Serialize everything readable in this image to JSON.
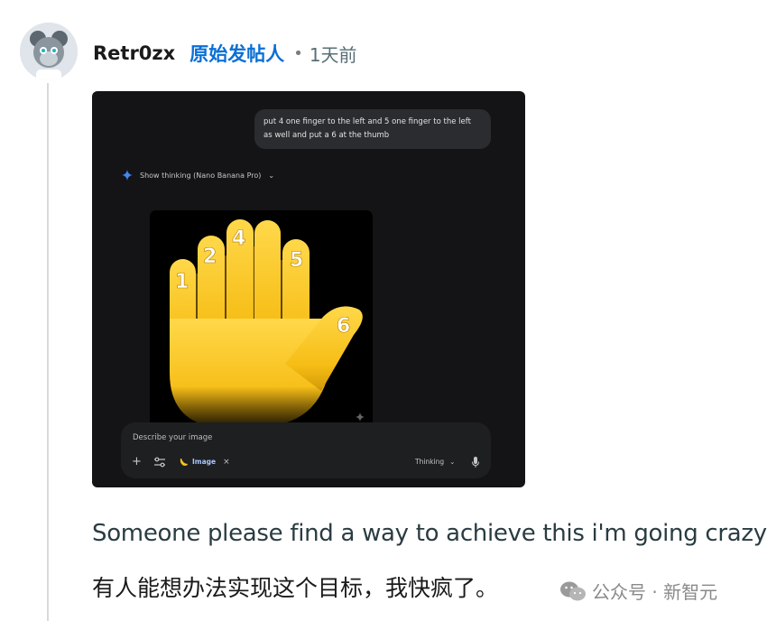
{
  "comment": {
    "username": "Retr0zx",
    "op_tag": "原始发帖人",
    "separator": "•",
    "time": "1天前",
    "text_en": "Someone please find a way to achieve this i'm going crazy",
    "text_zh": "有人能想办法实现这个目标，我快疯了。"
  },
  "media": {
    "prompt": "put 4 one finger to the left and 5 one finger to the left as well and put a 6 at the thumb",
    "thinking_label": "Show thinking (Nano Banana Pro)",
    "finger_numbers": [
      "1",
      "2",
      "4",
      "5",
      "6"
    ],
    "input_placeholder": "Describe your image",
    "chip_label": "Image",
    "mode_label": "Thinking"
  },
  "watermark": {
    "text": "公众号 · 新智元"
  },
  "colors": {
    "op_tag": "#0a6fd6",
    "hand": "#f7c21b",
    "media_bg": "#141416"
  }
}
